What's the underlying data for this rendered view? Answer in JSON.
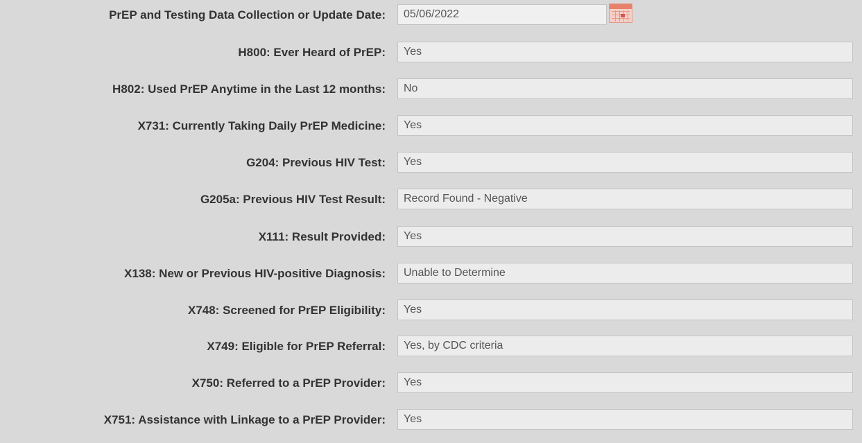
{
  "form": {
    "date_row": {
      "label": "PrEP and Testing Data Collection or Update Date:",
      "value": "05/06/2022",
      "icon": "calendar-icon"
    },
    "rows": [
      {
        "label": "H800: Ever Heard of PrEP:",
        "value": "Yes"
      },
      {
        "label": "H802: Used PrEP Anytime in the Last 12 months:",
        "value": "No"
      },
      {
        "label": "X731: Currently Taking Daily PrEP Medicine:",
        "value": "Yes"
      },
      {
        "label": "G204: Previous HIV Test:",
        "value": "Yes"
      },
      {
        "label": "G205a: Previous HIV Test Result:",
        "value": "Record Found - Negative"
      },
      {
        "label": "X111: Result Provided:",
        "value": "Yes"
      },
      {
        "label": "X138: New or Previous HIV-positive Diagnosis:",
        "value": "Unable to Determine"
      },
      {
        "label": "X748: Screened for PrEP Eligibility:",
        "value": "Yes"
      },
      {
        "label": "X749: Eligible for PrEP Referral:",
        "value": "Yes, by CDC criteria"
      },
      {
        "label": "X750: Referred to a PrEP Provider:",
        "value": "Yes"
      },
      {
        "label": "X751: Assistance with Linkage to a PrEP Provider:",
        "value": "Yes"
      }
    ]
  }
}
